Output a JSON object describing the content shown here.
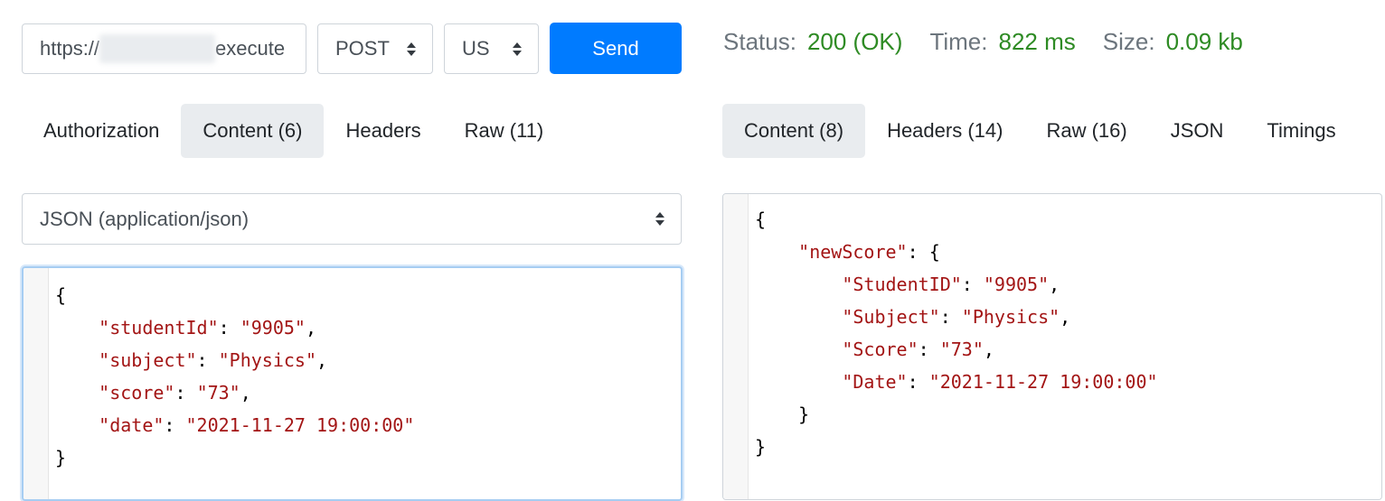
{
  "request": {
    "url_prefix": "https://",
    "url_suffix": "execute",
    "method": "POST",
    "region": "US",
    "send_label": "Send",
    "tabs": [
      {
        "label": "Authorization",
        "active": false
      },
      {
        "label": "Content (6)",
        "active": true
      },
      {
        "label": "Headers",
        "active": false
      },
      {
        "label": "Raw (11)",
        "active": false
      }
    ],
    "content_type": "JSON (application/json)",
    "body": {
      "open": "{",
      "close": "}",
      "fields": [
        {
          "key": "\"studentId\"",
          "value": "\"9905\""
        },
        {
          "key": "\"subject\"",
          "value": "\"Physics\""
        },
        {
          "key": "\"score\"",
          "value": "\"73\""
        },
        {
          "key": "\"date\"",
          "value": "\"2021-11-27 19:00:00\""
        }
      ]
    }
  },
  "response": {
    "status_label": "Status:",
    "status_value": "200 (OK)",
    "time_label": "Time:",
    "time_value": "822 ms",
    "size_label": "Size:",
    "size_value": "0.09 kb",
    "tabs": [
      {
        "label": "Content (8)",
        "active": true
      },
      {
        "label": "Headers (14)",
        "active": false
      },
      {
        "label": "Raw (16)",
        "active": false
      },
      {
        "label": "JSON",
        "active": false
      },
      {
        "label": "Timings",
        "active": false
      }
    ],
    "body": {
      "open": "{",
      "outer_key": "\"newScore\"",
      "inner_open": "{",
      "fields": [
        {
          "key": "\"StudentID\"",
          "value": "\"9905\""
        },
        {
          "key": "\"Subject\"",
          "value": "\"Physics\""
        },
        {
          "key": "\"Score\"",
          "value": "\"73\""
        },
        {
          "key": "\"Date\"",
          "value": "\"2021-11-27 19:00:00\""
        }
      ],
      "inner_close": "}",
      "close": "}"
    }
  },
  "colors": {
    "send_button": "#007bff",
    "status_ok": "#2e8b24",
    "json_string": "#a31515",
    "active_tab": "#e9ecef"
  }
}
